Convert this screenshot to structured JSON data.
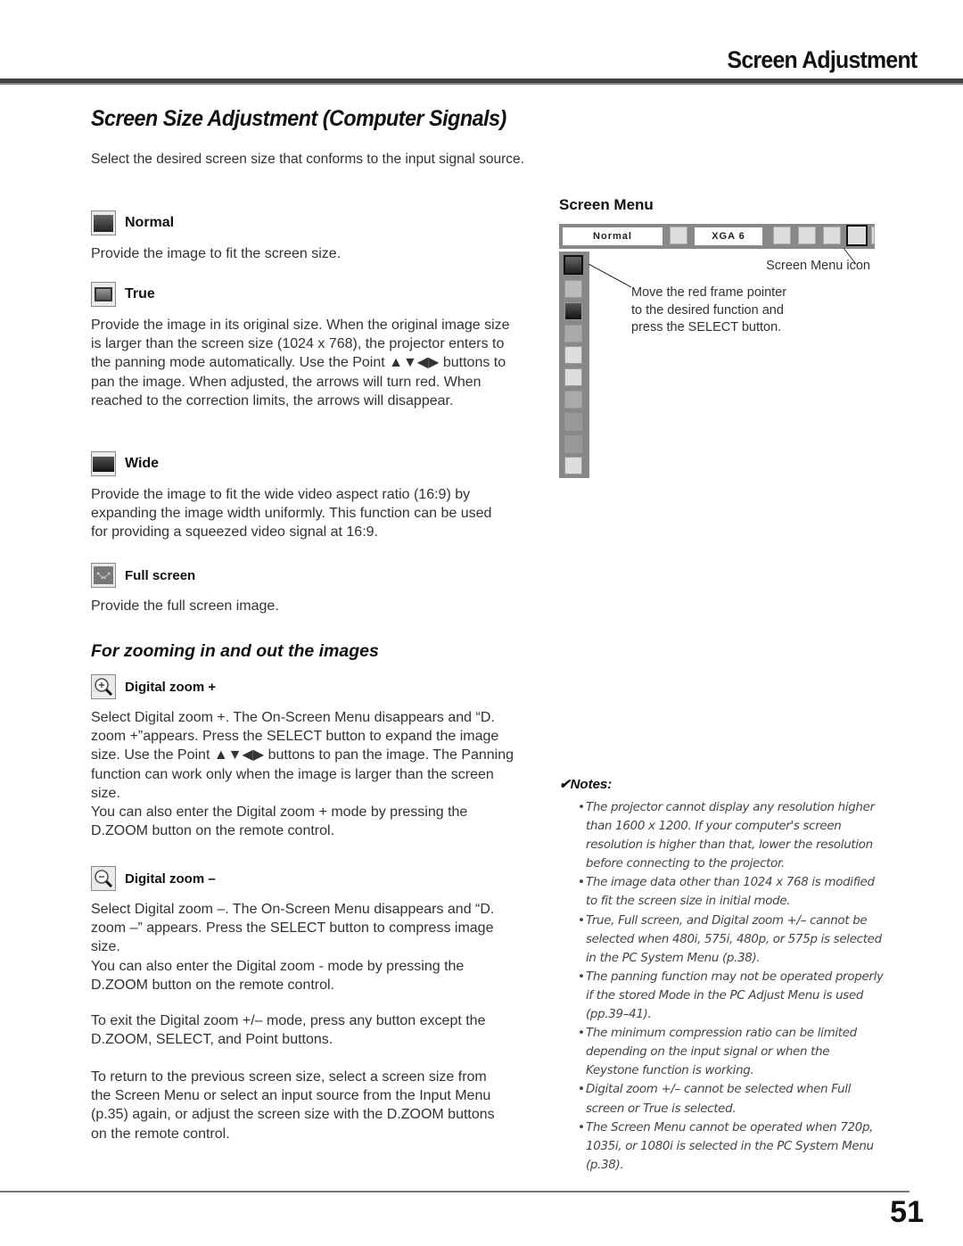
{
  "header": {
    "section_title": "Screen Adjustment"
  },
  "page": {
    "title": "Screen Size Adjustment (Computer Signals)",
    "intro": "Select the desired screen size that conforms to the input signal source.",
    "page_number": "51"
  },
  "items": [
    {
      "icon": "normal-screen-icon",
      "label": "Normal",
      "text": [
        "Provide the image to fit the screen size."
      ]
    },
    {
      "icon": "true-screen-icon",
      "label": "True",
      "text": [
        "Provide the image in its original size. When the original image size is larger than the screen size (1024 x 768), the projector enters to the panning mode automatically. Use the Point ▲▼◀▶ buttons to pan the image. When adjusted, the arrows will turn red. When reached to the correction limits, the arrows will disappear."
      ]
    },
    {
      "icon": "wide-screen-icon",
      "label": "Wide",
      "text": [
        "Provide the image to fit the wide video aspect ratio (16:9) by expanding the image width uniformly. This function can be used for providing a squeezed video signal at 16:9."
      ]
    },
    {
      "icon": "full-screen-icon",
      "label": "Full screen",
      "text": [
        "Provide the full screen image."
      ]
    }
  ],
  "zoom_section": {
    "title": "For zooming in and out the images",
    "items": [
      {
        "icon": "zoom-in-icon",
        "label": "Digital zoom +",
        "text": [
          "Select Digital zoom +. The On-Screen Menu disappears and “D. zoom +”appears. Press the SELECT button to expand the image size. Use the Point ▲▼◀▶ buttons to pan the image. The Panning function can work only when the image is larger than the screen size.",
          "You can also enter the Digital zoom + mode by pressing the D.ZOOM button on the remote control."
        ]
      },
      {
        "icon": "zoom-out-icon",
        "label": "Digital zoom –",
        "text": [
          "Select Digital zoom –. The On-Screen Menu disappears and “D. zoom –” appears. Press the SELECT button to compress image size.",
          "You can also enter the Digital zoom - mode by pressing the D.ZOOM button on the remote control."
        ]
      }
    ],
    "exit_text": "To exit the Digital zoom +/– mode, press any button except the D.ZOOM, SELECT, and Point buttons.",
    "return_text": "To return to the previous screen size, select a screen size from the Screen Menu or select an input source from the Input Menu (p.35) again, or adjust the screen size with the D.ZOOM buttons on the remote control."
  },
  "screen_menu": {
    "title": "Screen Menu",
    "osd_mode_value": "Normal",
    "osd_signal_value": "XGA 6",
    "icon_callout": "Screen Menu icon",
    "pointer_callout": [
      "Move the red frame pointer",
      "to the desired function and",
      "press the SELECT button."
    ],
    "side_icons": [
      "normal-icon",
      "true-icon",
      "wide-icon",
      "full-screen-icon",
      "zoom-in-icon",
      "zoom-out-icon",
      "keystone-icon",
      "ceiling-icon",
      "rear-icon",
      "exit-icon"
    ]
  },
  "notes": {
    "title": "Notes:",
    "items": [
      "The projector cannot display any resolution higher than 1600 x 1200. If your computer's screen resolution is higher than that, lower the resolution before connecting to the projector.",
      "The image data other than 1024 x 768 is modified to fit the screen size in initial mode.",
      "True, Full screen, and Digital zoom +/– cannot be selected when 480i, 575i, 480p, or 575p is selected in the PC System Menu (p.38).",
      "The panning function may not be operated properly if the stored Mode in the PC Adjust Menu is used (pp.39–41).",
      "The minimum compression ratio can be limited depending on the input signal or when the Keystone function is working.",
      "Digital zoom +/– cannot be selected when Full screen or True is selected.",
      "The Screen Menu cannot be operated when 720p, 1035i, or 1080i is selected in the PC System Menu (p.38)."
    ]
  }
}
